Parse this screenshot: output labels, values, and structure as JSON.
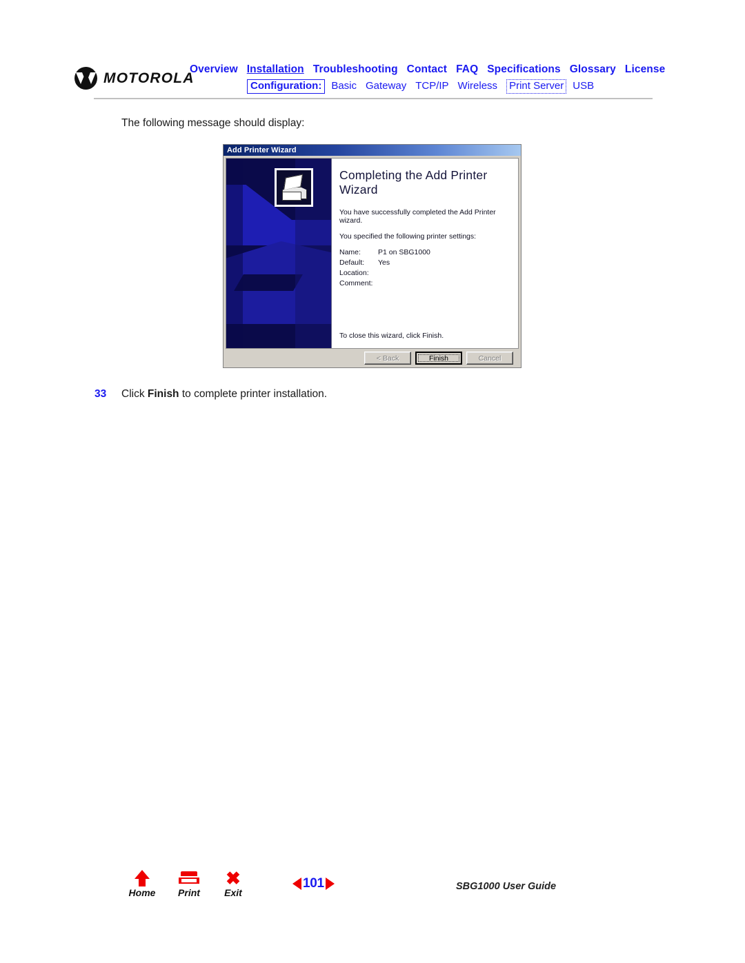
{
  "header": {
    "brand": "MOTOROLA",
    "nav_primary": [
      {
        "label": "Overview",
        "underlined": false
      },
      {
        "label": "Installation",
        "underlined": true
      },
      {
        "label": "Troubleshooting",
        "underlined": false
      },
      {
        "label": "Contact",
        "underlined": false
      },
      {
        "label": "FAQ",
        "underlined": false
      },
      {
        "label": "Specifications",
        "underlined": false
      },
      {
        "label": "Glossary",
        "underlined": false
      },
      {
        "label": "License",
        "underlined": false
      }
    ],
    "config_label": "Configuration:",
    "nav_secondary": [
      {
        "label": "Basic",
        "style": "plain"
      },
      {
        "label": "Gateway",
        "style": "plain"
      },
      {
        "label": "TCP/IP",
        "style": "plain"
      },
      {
        "label": "Wireless",
        "style": "plain"
      },
      {
        "label": "Print Server",
        "style": "dotted"
      },
      {
        "label": "USB",
        "style": "plain"
      }
    ],
    "link_color": "#1a1af0"
  },
  "content": {
    "intro": "The following message should display:",
    "step_number": "33",
    "step_text_before": "Click ",
    "step_text_bold": "Finish",
    "step_text_after": " to complete printer installation."
  },
  "wizard": {
    "window_title": "Add Printer Wizard",
    "heading": "Completing the Add Printer Wizard",
    "paragraph_1": "You have successfully completed the Add Printer wizard.",
    "paragraph_2": "You specified the following printer settings:",
    "settings": [
      {
        "key": "Name:",
        "value": "P1 on SBG1000"
      },
      {
        "key": "Default:",
        "value": "Yes"
      },
      {
        "key": "Location:",
        "value": ""
      },
      {
        "key": "Comment:",
        "value": ""
      }
    ],
    "closing_text": "To close this wizard, click Finish.",
    "buttons": [
      {
        "label": "< Back",
        "state": "disabled"
      },
      {
        "label": "Finish",
        "state": "default"
      },
      {
        "label": "Cancel",
        "state": "disabled"
      }
    ],
    "titlebar_color_start": "#0a246a",
    "titlebar_color_end": "#a6c8f0",
    "graphic_bg": "#0a0a4a"
  },
  "footer": {
    "home_label": "Home",
    "print_label": "Print",
    "exit_label": "Exit",
    "page_number": "101",
    "doc_title": "SBG1000 User Guide",
    "accent_color": "#ee0000"
  }
}
